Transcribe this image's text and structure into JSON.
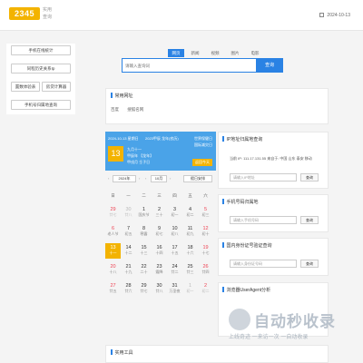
{
  "header": {
    "logo_text": "2345",
    "logo_sub1": "实用",
    "logo_sub2": "查询",
    "date": "2024-10-13"
  },
  "sidebar": {
    "items": [
      {
        "label": "手机在线统计"
      },
      {
        "label": "同程历史关系Ip"
      },
      {
        "label": "置数体验表"
      },
      {
        "label": "房贷计算器"
      },
      {
        "label": "手机号归属地查询"
      }
    ]
  },
  "search": {
    "tabs": [
      "网页",
      "新闻",
      "视频",
      "图片",
      "电影"
    ],
    "placeholder": "请输入查询词",
    "button": "查询"
  },
  "sites_panel": {
    "title": "常用网址",
    "links": [
      "百度",
      "搜狐名网"
    ]
  },
  "calendar": {
    "header_date": "2024-10-13 星期日",
    "header_cn_year": "2023甲辰 龙年(农历)",
    "header_right1": "世界保健日",
    "header_right2": "国际减灾日",
    "day_big": "13",
    "lunar_day": "九月十一",
    "lunar_line2": "甲辰年 【龙年】",
    "lunar_line3": "甲戌月 壬子日",
    "today_btn": "返回今天",
    "year_select": "2024年",
    "month_select": "10月",
    "holiday_select": "假日安排",
    "weekdays": [
      "日",
      "一",
      "二",
      "三",
      "四",
      "五",
      "六"
    ],
    "cells": [
      {
        "d": "29",
        "l": "廿七",
        "other": true,
        "weekend": true
      },
      {
        "d": "30",
        "l": "廿八",
        "other": true
      },
      {
        "d": "1",
        "l": "国庆节"
      },
      {
        "d": "2",
        "l": "三十"
      },
      {
        "d": "3",
        "l": "初一"
      },
      {
        "d": "4",
        "l": "初二"
      },
      {
        "d": "5",
        "l": "初三",
        "weekend": true
      },
      {
        "d": "6",
        "l": "老人节",
        "weekend": true
      },
      {
        "d": "7",
        "l": "初五"
      },
      {
        "d": "8",
        "l": "寒露"
      },
      {
        "d": "9",
        "l": "初七"
      },
      {
        "d": "10",
        "l": "初八"
      },
      {
        "d": "11",
        "l": "初九"
      },
      {
        "d": "12",
        "l": "初十",
        "weekend": true
      },
      {
        "d": "13",
        "l": "十一",
        "today": true,
        "weekend": true
      },
      {
        "d": "14",
        "l": "十二"
      },
      {
        "d": "15",
        "l": "十三"
      },
      {
        "d": "16",
        "l": "十四"
      },
      {
        "d": "17",
        "l": "十五"
      },
      {
        "d": "18",
        "l": "十六"
      },
      {
        "d": "19",
        "l": "十七",
        "weekend": true
      },
      {
        "d": "20",
        "l": "十八",
        "weekend": true
      },
      {
        "d": "21",
        "l": "十九"
      },
      {
        "d": "22",
        "l": "二十"
      },
      {
        "d": "23",
        "l": "霜降"
      },
      {
        "d": "24",
        "l": "廿二"
      },
      {
        "d": "25",
        "l": "廿三"
      },
      {
        "d": "26",
        "l": "廿四",
        "weekend": true
      },
      {
        "d": "27",
        "l": "廿五",
        "weekend": true
      },
      {
        "d": "28",
        "l": "廿六"
      },
      {
        "d": "29",
        "l": "廿七"
      },
      {
        "d": "30",
        "l": "廿八"
      },
      {
        "d": "31",
        "l": "万圣夜"
      },
      {
        "d": "1",
        "l": "初一",
        "other": true
      },
      {
        "d": "2",
        "l": "初二",
        "other": true,
        "weekend": true
      }
    ]
  },
  "ip_panel": {
    "title": "IP地址归属地查询",
    "info": "当前 IP: 111.17.131.55  来自于: 中国 山东 泰安 移动",
    "placeholder": "请输入IP地址",
    "button": "查询"
  },
  "phone_panel": {
    "title": "手机号码归属地",
    "placeholder": "请输入手机号码",
    "button": "查询"
  },
  "idcard_panel": {
    "title": "国内身份证号验证查询",
    "placeholder": "请输入身份证号码",
    "button": "查询"
  },
  "ua_panel": {
    "title": "浏览器UserAgent分析"
  },
  "watermark": {
    "text": "自动秒收录",
    "sub": "上线奇迹 一来访一次 一自动收录"
  },
  "tools_panel": {
    "title": "实用工具"
  }
}
